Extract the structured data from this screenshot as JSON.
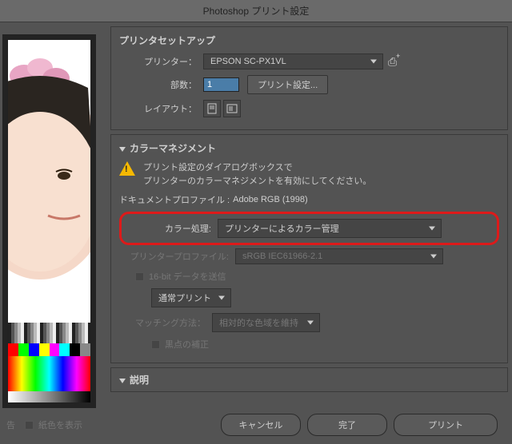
{
  "titlebar": "Photoshop プリント設定",
  "printerSetup": {
    "header": "プリンタセットアップ",
    "printerLabel": "プリンター：",
    "printerValue": "EPSON SC-PX1VL",
    "copiesLabel": "部数：",
    "copiesValue": "1",
    "printSettingsBtn": "プリント設定...",
    "layoutLabel": "レイアウト："
  },
  "colorMgmt": {
    "header": "カラーマネジメント",
    "warnLine1": "プリント設定のダイアログボックスで",
    "warnLine2": "プリンターのカラーマネジメントを有効にしてください。",
    "docProfileLabel": "ドキュメントプロファイル :",
    "docProfileValue": "Adobe RGB (1998)",
    "colorHandlingLabel": "カラー処理:",
    "colorHandlingValue": "プリンターによるカラー管理",
    "printerProfileLabel": "プリンタープロファイル:",
    "printerProfileValue": "sRGB IEC61966-2.1",
    "sendSixteenBit": "16-bit データを送信",
    "normalPrint": "通常プリント",
    "matchingLabel": "マッチング方法：",
    "matchingValue": "相対的な色域を維持",
    "blackPoint": "黒点の補正"
  },
  "description": {
    "header": "説明"
  },
  "bottom": {
    "warnSummary": "告",
    "paperDisplay": "紙色を表示",
    "cancel": "キャンセル",
    "done": "完了",
    "print": "プリント"
  }
}
